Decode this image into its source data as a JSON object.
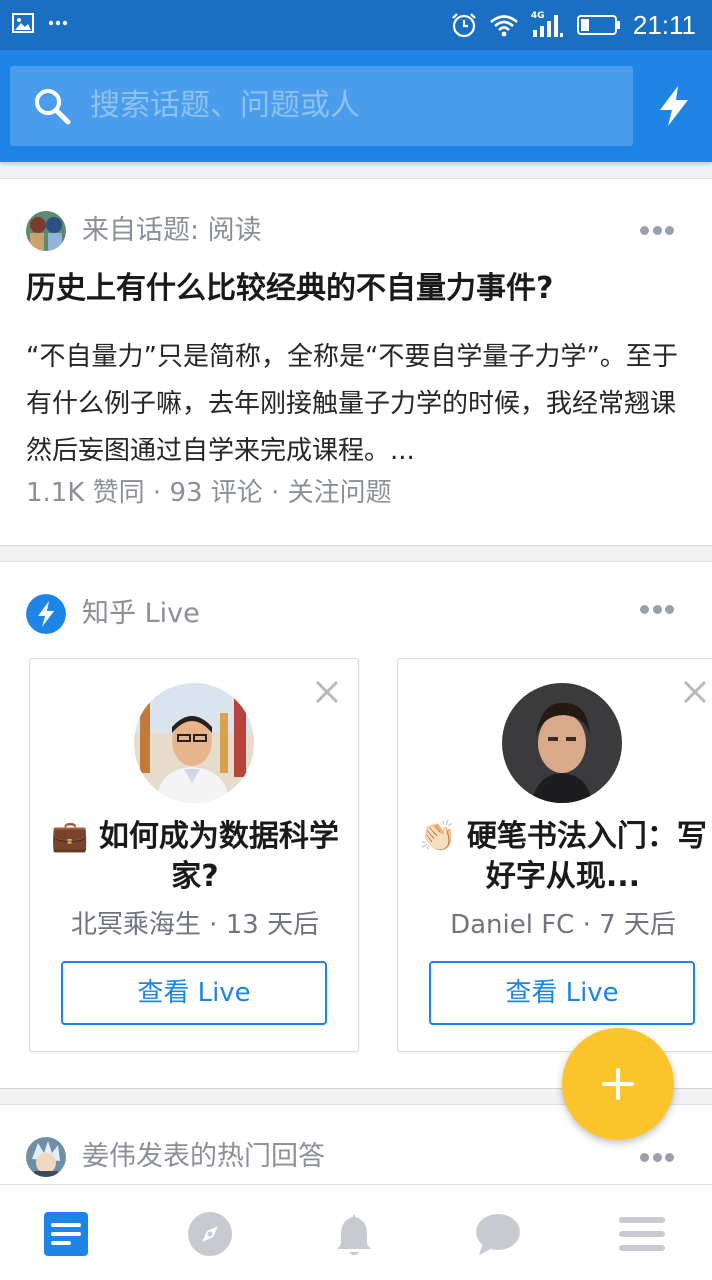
{
  "status_bar": {
    "time": "21:11",
    "network": "4G"
  },
  "search": {
    "placeholder": "搜索话题、问题或人"
  },
  "feed": [
    {
      "source": "来自话题: 阅读",
      "title": "历史上有什么比较经典的不自量力事件?",
      "excerpt": "“不自量力”只是简称，全称是“不要自学量子力学”。至于有什么例子嘛，去年刚接触量子力学的时候，我经常翘课然后妄图通过自学来完成课程。...",
      "stats": "1.1K 赞同 · 93 评论 · 关注问题"
    },
    {
      "source": "知乎 Live",
      "lives": [
        {
          "title": "💼 如何成为数据科学家?",
          "author_meta": "北冥乘海生 · 13 天后",
          "button": "查看 Live"
        },
        {
          "title": "👏🏻 硬笔书法入门：写好字从现...",
          "author_meta": "Daniel FC · 7 天后",
          "button": "查看 Live"
        }
      ]
    },
    {
      "source": "姜伟发表的热门回答"
    }
  ],
  "colors": {
    "brand": "#1e84e6",
    "fab": "#fcc42b",
    "status_bar": "#1b6fc2"
  },
  "icons": [
    "image-icon",
    "more-horizontal-icon",
    "alarm-icon",
    "wifi-icon",
    "signal-icon",
    "battery-icon",
    "search-icon",
    "lightning-icon",
    "close-icon",
    "plus-icon",
    "home-feed-icon",
    "explore-compass-icon",
    "notification-bell-icon",
    "message-bubble-icon",
    "menu-icon"
  ]
}
